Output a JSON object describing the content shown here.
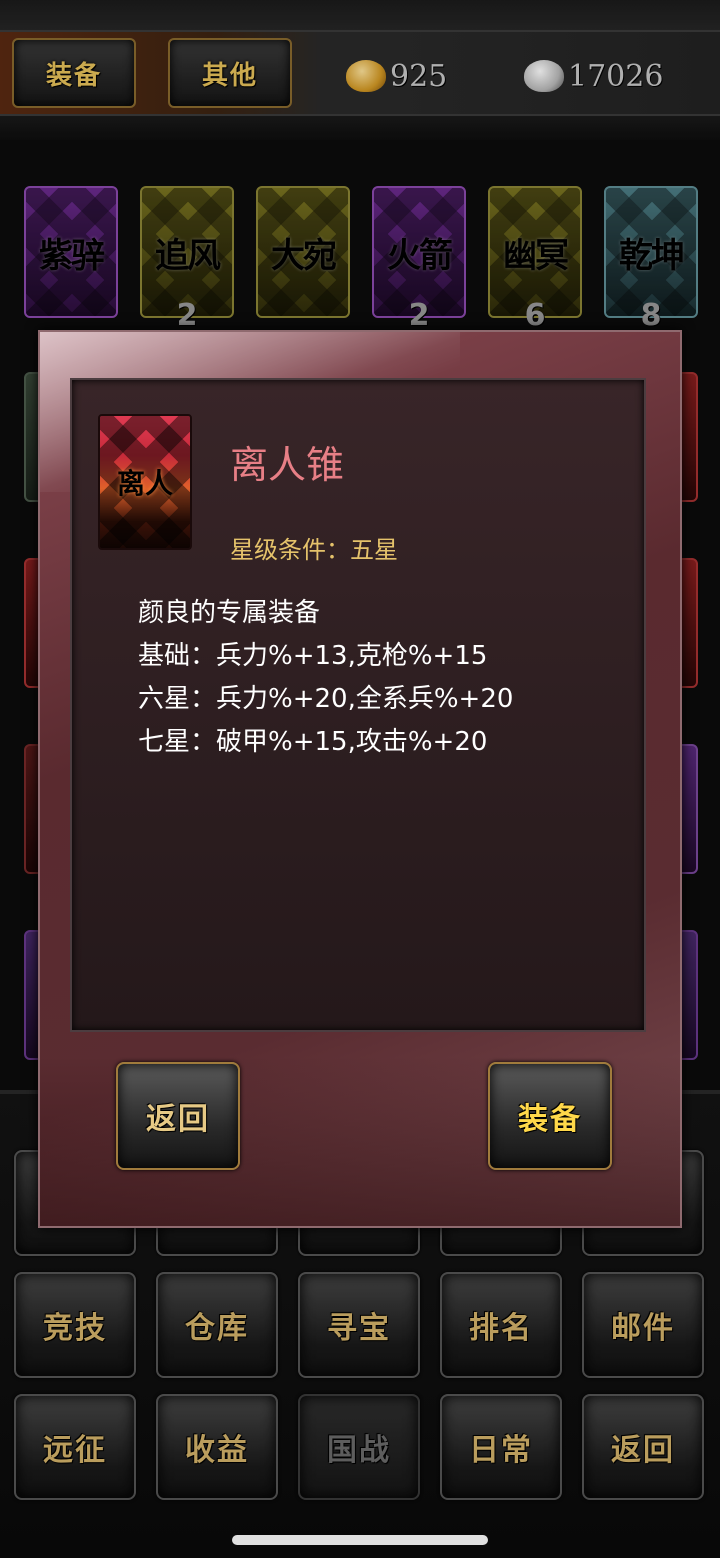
{
  "header": {
    "tabs": [
      "装备",
      "其他"
    ],
    "gold_amount": "925",
    "silver_amount": "17026"
  },
  "cards": [
    {
      "name": "紫骍",
      "count": "",
      "color": "#6b2a8e"
    },
    {
      "name": "追风",
      "count": "2",
      "color": "#7a7420"
    },
    {
      "name": "大宛",
      "count": "",
      "color": "#7a7420"
    },
    {
      "name": "火箭",
      "count": "2",
      "color": "#6b2a8e"
    },
    {
      "name": "幽冥",
      "count": "6",
      "color": "#7a7420"
    },
    {
      "name": "乾坤",
      "count": "8",
      "color": "#4d7e86"
    }
  ],
  "dialog": {
    "icon_label": "离人",
    "title": "离人锥",
    "star_requirement": "星级条件：五星",
    "description": [
      "颜良的专属装备",
      "基础：兵力%+13,克枪%+15",
      "六星：兵力%+20,全系兵%+20",
      "七星：破甲%+15,攻击%+20"
    ],
    "back_label": "返回",
    "equip_label": "装备"
  },
  "menu": {
    "row2": [
      "竞技",
      "仓库",
      "寻宝",
      "排名",
      "邮件"
    ],
    "row3": [
      "远征",
      "收益",
      "国战",
      "日常",
      "返回"
    ]
  },
  "colors": {
    "accent_gold": "#e5c36b",
    "title_pink": "#e77f86",
    "equip_yellow": "#ffd84a"
  }
}
